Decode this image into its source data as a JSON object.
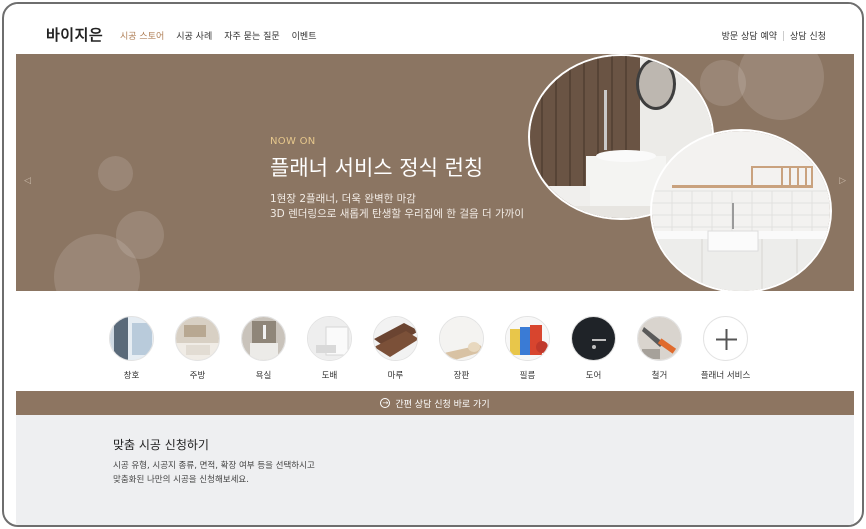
{
  "header": {
    "logo": "바이지은",
    "nav": [
      "시공 스토어",
      "시공 사례",
      "자주 묻는 질문",
      "이벤트"
    ],
    "nav_active_index": 0,
    "util": [
      "방문 상담 예약",
      "상담 신청"
    ]
  },
  "banner": {
    "eyebrow": "NOW ON",
    "title": "플래너 서비스 정식 런칭",
    "desc_line1": "1현장 2플래너, 더욱 완벽한 마감",
    "desc_line2": "3D 렌더링으로 새롭게 탄생할 우리집에 한 걸음 더 가까이",
    "prev_icon": "chevron-left-icon",
    "next_icon": "chevron-right-icon",
    "bg_color": "#8b7562",
    "eyebrow_color": "#e6c78c"
  },
  "categories": [
    {
      "label": "창호",
      "icon": "window-icon"
    },
    {
      "label": "주방",
      "icon": "kitchen-icon"
    },
    {
      "label": "욕실",
      "icon": "bathroom-icon"
    },
    {
      "label": "도배",
      "icon": "wallpaper-icon"
    },
    {
      "label": "마루",
      "icon": "flooring-icon"
    },
    {
      "label": "장판",
      "icon": "floor-sheet-icon"
    },
    {
      "label": "필름",
      "icon": "film-icon"
    },
    {
      "label": "도어",
      "icon": "door-icon"
    },
    {
      "label": "철거",
      "icon": "demolition-icon"
    },
    {
      "label": "플래너 서비스",
      "icon": "plus-icon"
    }
  ],
  "quick_bar": {
    "label": "간편 상담 신청 바로 가기",
    "icon": "arrow-circle-right-icon",
    "color": "#8d7561"
  },
  "request": {
    "title": "맞춤 시공 신청하기",
    "line1": "시공 유형, 시공지 종류, 면적, 확장 여부 등을 선택하시고",
    "line2": "맞춤화된 나만의 시공을 신청해보세요."
  }
}
